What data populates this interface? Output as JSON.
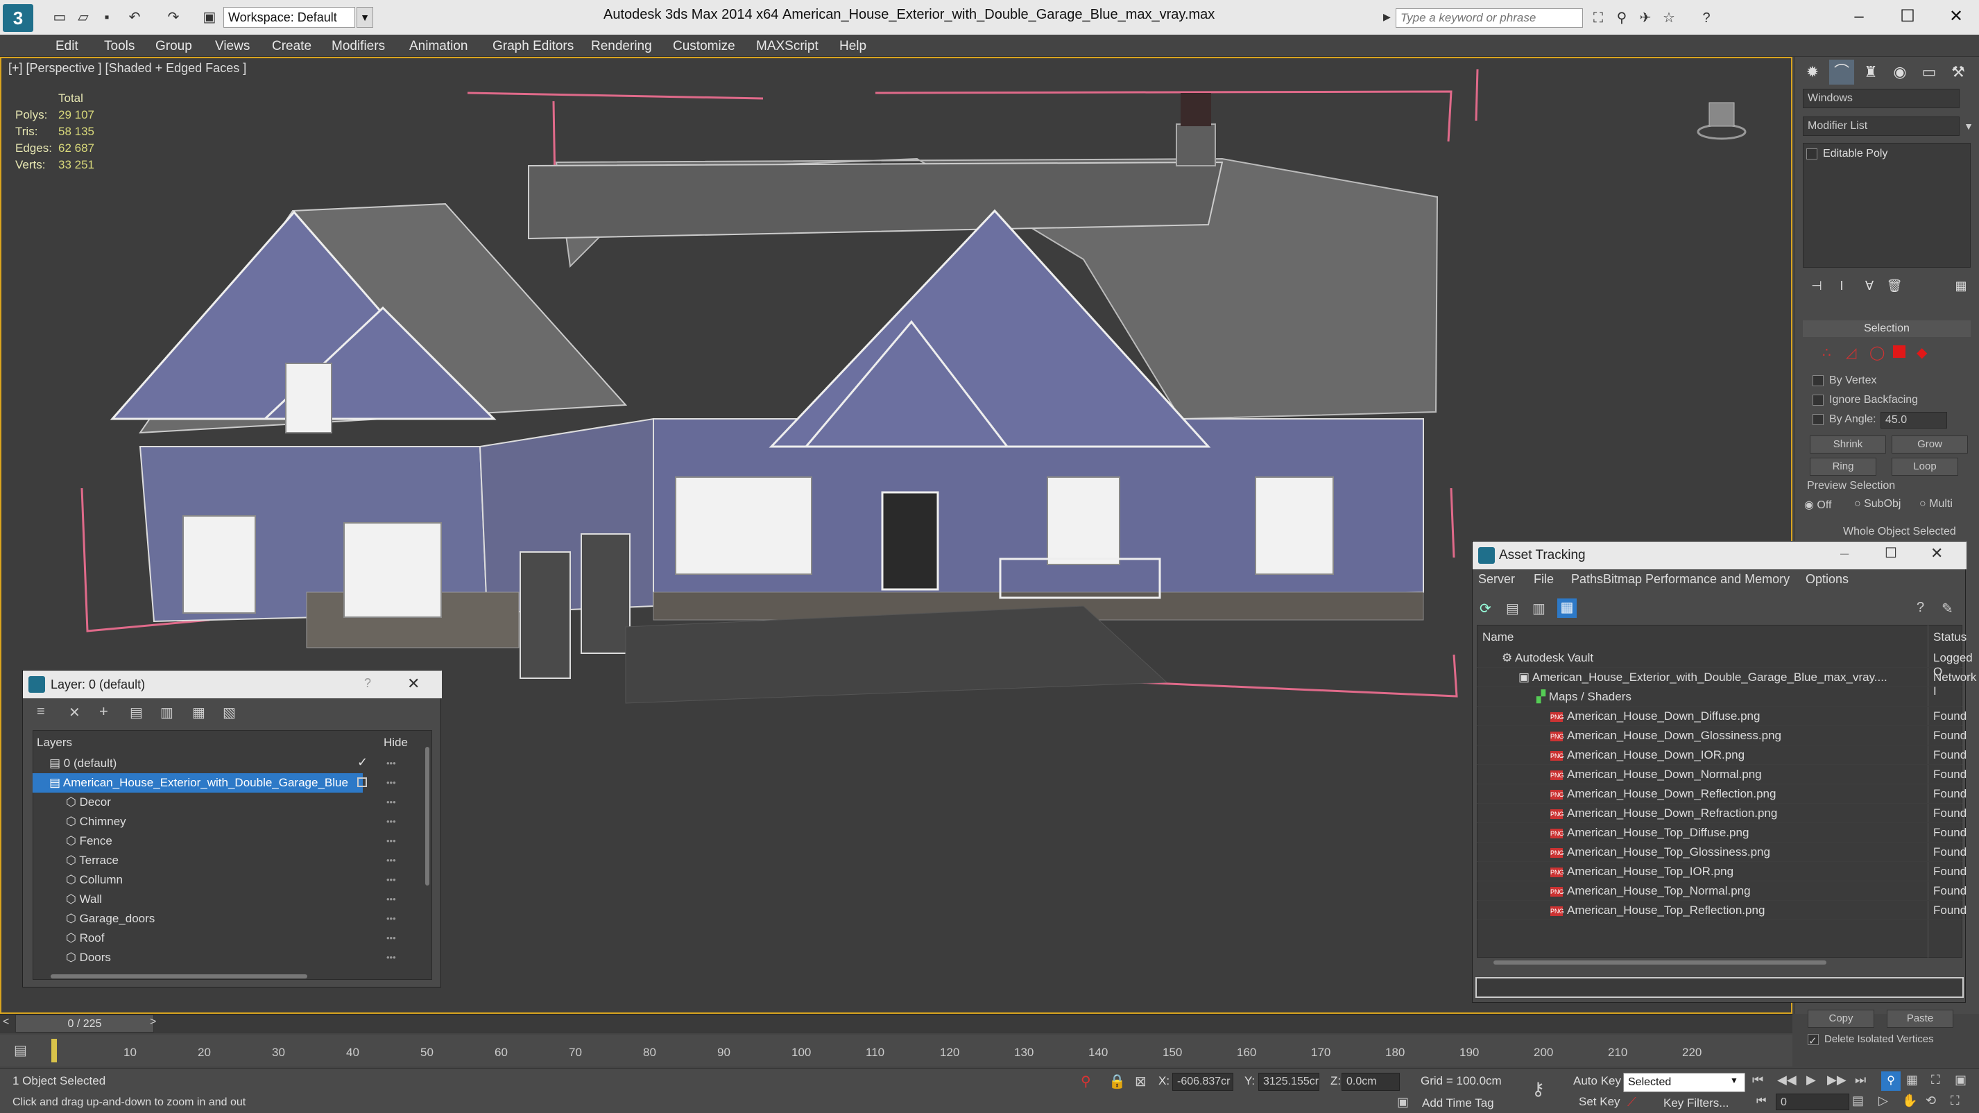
{
  "titlebar": {
    "workspace": "Workspace: Default",
    "app_title": "Autodesk 3ds Max  2014 x64",
    "doc_name": "American_House_Exterior_with_Double_Garage_Blue_max_vray.max",
    "search_placeholder": "Type a keyword or phrase"
  },
  "menu": [
    "Edit",
    "Tools",
    "Group",
    "Views",
    "Create",
    "Modifiers",
    "Animation",
    "Graph Editors",
    "Rendering",
    "Customize",
    "MAXScript",
    "Help"
  ],
  "viewport": {
    "label": "[+] [Perspective ] [Shaded + Edged Faces ]",
    "stats_header": "Total",
    "stats": [
      {
        "label": "Polys:",
        "value": "29 107"
      },
      {
        "label": "Tris:",
        "value": "58 135"
      },
      {
        "label": "Edges:",
        "value": "62 687"
      },
      {
        "label": "Verts:",
        "value": "33 251"
      }
    ]
  },
  "command_panel": {
    "windows_field": "Windows",
    "modifier_list": "Modifier List",
    "stack_item": "Editable Poly",
    "selection_title": "Selection",
    "by_vertex": "By Vertex",
    "ignore_backfacing": "Ignore Backfacing",
    "by_angle": "By Angle:",
    "angle_value": "45.0",
    "shrink": "Shrink",
    "grow": "Grow",
    "ring": "Ring",
    "loop": "Loop",
    "preview_selection": "Preview Selection",
    "off": "Off",
    "subobj": "SubObj",
    "multi": "Multi",
    "whole_object": "Whole Object Selected",
    "copy": "Copy",
    "paste": "Paste",
    "delete_isolated": "Delete Isolated Vertices"
  },
  "layer_panel": {
    "title": "Layer: 0 (default)",
    "help": "?",
    "col_layers": "Layers",
    "col_hide": "Hide",
    "rows": [
      {
        "label": "0 (default)",
        "indent": 0
      },
      {
        "label": "American_House_Exterior_with_Double_Garage_Blue",
        "indent": 0
      },
      {
        "label": "Decor",
        "indent": 1
      },
      {
        "label": "Chimney",
        "indent": 1
      },
      {
        "label": "Fence",
        "indent": 1
      },
      {
        "label": "Terrace",
        "indent": 1
      },
      {
        "label": "Collumn",
        "indent": 1
      },
      {
        "label": "Wall",
        "indent": 1
      },
      {
        "label": "Garage_doors",
        "indent": 1
      },
      {
        "label": "Roof",
        "indent": 1
      },
      {
        "label": "Doors",
        "indent": 1
      }
    ]
  },
  "asset_tracking": {
    "title": "Asset Tracking",
    "menu": [
      "Server",
      "File",
      "Paths",
      "Bitmap Performance and Memory",
      "Options"
    ],
    "col_name": "Name",
    "col_status": "Status",
    "rows": [
      {
        "name": "Autodesk Vault",
        "status": "Logged O",
        "level": 0
      },
      {
        "name": "American_House_Exterior_with_Double_Garage_Blue_max_vray....",
        "status": "Network I",
        "level": 1
      },
      {
        "name": "Maps / Shaders",
        "status": "",
        "level": 2
      },
      {
        "name": "American_House_Down_Diffuse.png",
        "status": "Found",
        "level": 3
      },
      {
        "name": "American_House_Down_Glossiness.png",
        "status": "Found",
        "level": 3
      },
      {
        "name": "American_House_Down_IOR.png",
        "status": "Found",
        "level": 3
      },
      {
        "name": "American_House_Down_Normal.png",
        "status": "Found",
        "level": 3
      },
      {
        "name": "American_House_Down_Reflection.png",
        "status": "Found",
        "level": 3
      },
      {
        "name": "American_House_Down_Refraction.png",
        "status": "Found",
        "level": 3
      },
      {
        "name": "American_House_Top_Diffuse.png",
        "status": "Found",
        "level": 3
      },
      {
        "name": "American_House_Top_Glossiness.png",
        "status": "Found",
        "level": 3
      },
      {
        "name": "American_House_Top_IOR.png",
        "status": "Found",
        "level": 3
      },
      {
        "name": "American_House_Top_Normal.png",
        "status": "Found",
        "level": 3
      },
      {
        "name": "American_House_Top_Reflection.png",
        "status": "Found",
        "level": 3
      }
    ]
  },
  "timeline": {
    "frame": "0 / 225",
    "ticks": [
      "10",
      "20",
      "30",
      "40",
      "50",
      "60",
      "70",
      "80",
      "90",
      "100",
      "110",
      "120",
      "130",
      "140",
      "150",
      "160",
      "170",
      "180",
      "190",
      "200",
      "210",
      "220"
    ]
  },
  "status": {
    "selected": "1 Object Selected",
    "hint": "Click and drag up-and-down to zoom in and out",
    "x_label": "X:",
    "x_value": "-606.837cr",
    "y_label": "Y:",
    "y_value": "3125.155cr",
    "z_label": "Z:",
    "z_value": "0.0cm",
    "grid": "Grid = 100.0cm",
    "add_time_tag": "Add Time Tag",
    "auto_key": "Auto Key",
    "set_key": "Set Key",
    "selected_dropdown": "Selected",
    "key_filters": "Key Filters...",
    "frame_field": "0"
  },
  "colors": {
    "accent": "#2d79c7",
    "viewport_border": "#d9a41f",
    "selection_box": "#e06a8a"
  }
}
